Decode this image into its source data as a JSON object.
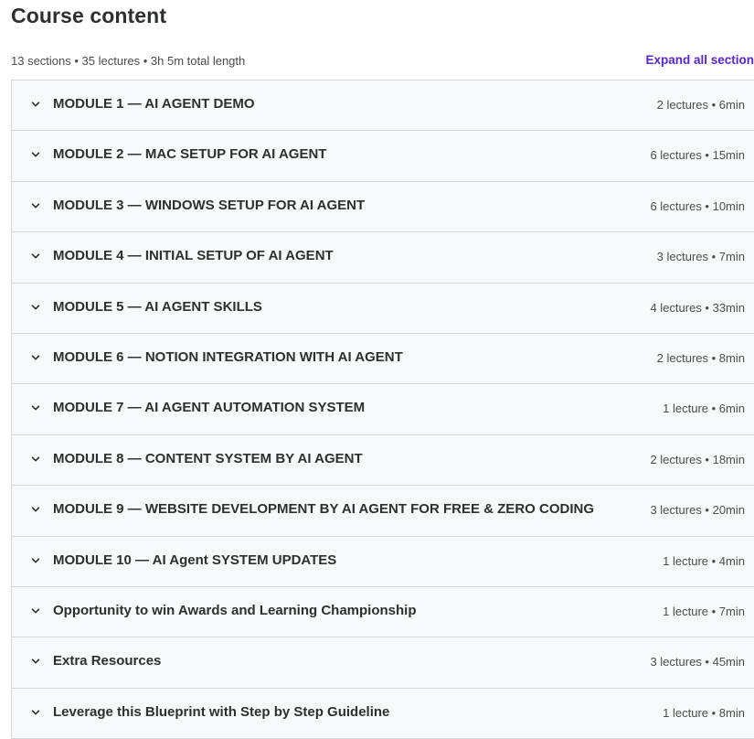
{
  "header": {
    "title": "Course content",
    "stats": "13 sections • 35 lectures • 3h 5m total length",
    "expand_all_label": "Expand all section"
  },
  "sections": [
    {
      "title": "MODULE 1 — AI AGENT DEMO",
      "info": "2 lectures • 6min"
    },
    {
      "title": "MODULE 2 — MAC SETUP FOR AI AGENT",
      "info": "6 lectures • 15min"
    },
    {
      "title": "MODULE 3 — WINDOWS SETUP FOR AI AGENT",
      "info": "6 lectures • 10min"
    },
    {
      "title": "MODULE 4 — INITIAL SETUP OF AI AGENT",
      "info": "3 lectures • 7min"
    },
    {
      "title": "MODULE 5 — AI AGENT SKILLS",
      "info": "4 lectures • 33min"
    },
    {
      "title": "MODULE 6 — NOTION INTEGRATION WITH AI AGENT",
      "info": "2 lectures • 8min"
    },
    {
      "title": "MODULE 7 — AI AGENT AUTOMATION SYSTEM",
      "info": "1 lecture • 6min"
    },
    {
      "title": "MODULE 8 — CONTENT SYSTEM BY AI AGENT",
      "info": "2 lectures • 18min"
    },
    {
      "title": "MODULE 9 — WEBSITE DEVELOPMENT BY AI AGENT FOR FREE & ZERO CODING",
      "info": "3 lectures • 20min"
    },
    {
      "title": "MODULE 10 — AI Agent SYSTEM UPDATES",
      "info": "1 lecture • 4min"
    },
    {
      "title": "Opportunity to win Awards and Learning Championship",
      "info": "1 lecture • 7min"
    },
    {
      "title": "Extra Resources",
      "info": "3 lectures • 45min"
    },
    {
      "title": "Leverage this Blueprint with Step by Step Guideline",
      "info": "1 lecture • 8min"
    }
  ],
  "icons": {
    "section_toggle": "chevron-down-icon"
  },
  "colors": {
    "accent": "#5624d0",
    "section_bg": "#f7f9fa",
    "border": "#d1d7dc",
    "text": "#2d2f31"
  }
}
